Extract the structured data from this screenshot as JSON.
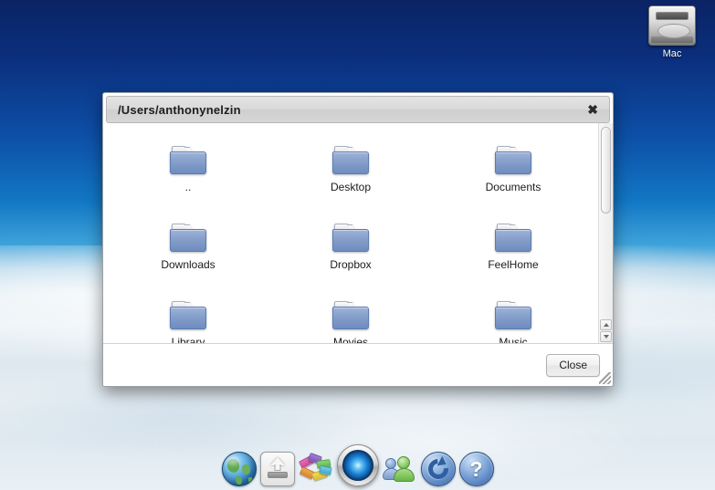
{
  "desktop": {
    "drive": {
      "label": "Mac",
      "icon": "hard-drive-icon"
    }
  },
  "window": {
    "title": "/Users/anthonynelzin",
    "close_icon": "✖",
    "files": [
      {
        "name": "..",
        "icon": "folder-icon"
      },
      {
        "name": "Desktop",
        "icon": "folder-icon"
      },
      {
        "name": "Documents",
        "icon": "folder-icon"
      },
      {
        "name": "Downloads",
        "icon": "folder-icon"
      },
      {
        "name": "Dropbox",
        "icon": "folder-icon"
      },
      {
        "name": "FeelHome",
        "icon": "folder-icon"
      },
      {
        "name": "Library",
        "icon": "folder-icon"
      },
      {
        "name": "Movies",
        "icon": "folder-icon"
      },
      {
        "name": "Music",
        "icon": "folder-icon"
      }
    ],
    "footer": {
      "close_label": "Close"
    }
  },
  "dock": {
    "items": [
      {
        "name": "globe-icon",
        "label": "Web Browser"
      },
      {
        "name": "eject-icon",
        "label": "Eject"
      },
      {
        "name": "blocks-icon",
        "label": "Widgets"
      },
      {
        "name": "orb-icon",
        "label": "System"
      },
      {
        "name": "users-icon",
        "label": "Users"
      },
      {
        "name": "refresh-icon",
        "label": "Refresh"
      },
      {
        "name": "help-icon",
        "label": "Help",
        "glyph": "?"
      }
    ]
  },
  "colors": {
    "sky_top": "#0a2364",
    "sky_mid": "#1277c4",
    "cloud": "#e6eef3",
    "folder_blue": "#8aa3cd",
    "titlebar_gray": "#d9d9d9"
  }
}
